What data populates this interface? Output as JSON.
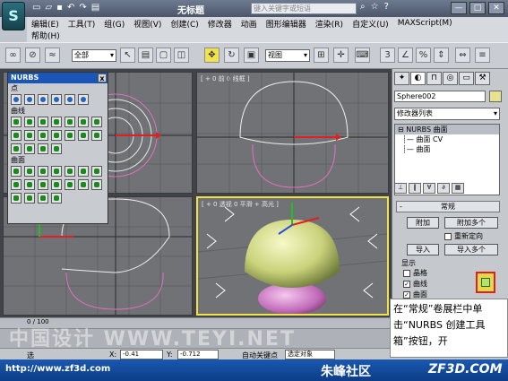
{
  "titlebar": {
    "window_title": "无标题",
    "search_placeholder": "键入关键字或短语",
    "controls": [
      "—",
      "□",
      "✕"
    ]
  },
  "menu": {
    "row1": [
      "编辑(E)",
      "工具(T)",
      "组(G)",
      "视图(V)",
      "创建(C)",
      "修改器",
      "动画",
      "图形编辑器",
      "渲染(R)",
      "自定义(U)",
      "MAXScript(M)"
    ],
    "row2": [
      "帮助(H)"
    ]
  },
  "toolbar": {
    "selection_filter": "全部",
    "reference_coord": "视图"
  },
  "viewports": {
    "top_right_label": "[ + 0 前 0 线框 ]",
    "perspective_label": "[ + 0 透视 0 平滑 + 高光 ]"
  },
  "nurbs_panel": {
    "title": "NURBS",
    "close": "x",
    "section_points": "点",
    "section_curves": "曲线",
    "section_surfaces": "曲面",
    "points_count": 7,
    "curves_count": 18,
    "surfaces_count": 18
  },
  "command_panel": {
    "object_name": "Sphere002",
    "object_color": "#e6e38e",
    "modifier_list": "修改器列表",
    "stack": [
      "NURBS 曲面",
      "曲面 CV",
      "曲面"
    ],
    "rollout_title": "常规",
    "rollout_toggle": "-",
    "attach": "附加",
    "attach_multiple": "附加多个",
    "reorient": "重新定向",
    "import": "导入",
    "import_multiple": "导入多个",
    "display_label": "显示",
    "checks": [
      {
        "label": "晶格",
        "checked": false
      },
      {
        "label": "曲线",
        "checked": true
      },
      {
        "label": "曲面",
        "checked": true
      }
    ]
  },
  "callout": {
    "text": "在“常规”卷展栏中单击“NURBS 创建工具箱”按钮，开"
  },
  "timeline": {
    "frame": "0 / 100"
  },
  "watermark": "中国设计 WWW.TEYI.NET",
  "statusbar": {
    "selected": "选",
    "x_label": "X:",
    "x_value": "-0.41",
    "y_label": "Y:",
    "y_value": "-0.712",
    "auto_key": "自动关键点",
    "selected_obj": "选定对象"
  },
  "footer": {
    "url": "http://www.zf3d.com",
    "brand": "朱峰社区",
    "site": "ZF3D.COM"
  },
  "colors": {
    "viewport_bg": "#707275",
    "active_border": "#f2e24a",
    "highlight": "#e02020",
    "footer": "#1a58b0"
  }
}
